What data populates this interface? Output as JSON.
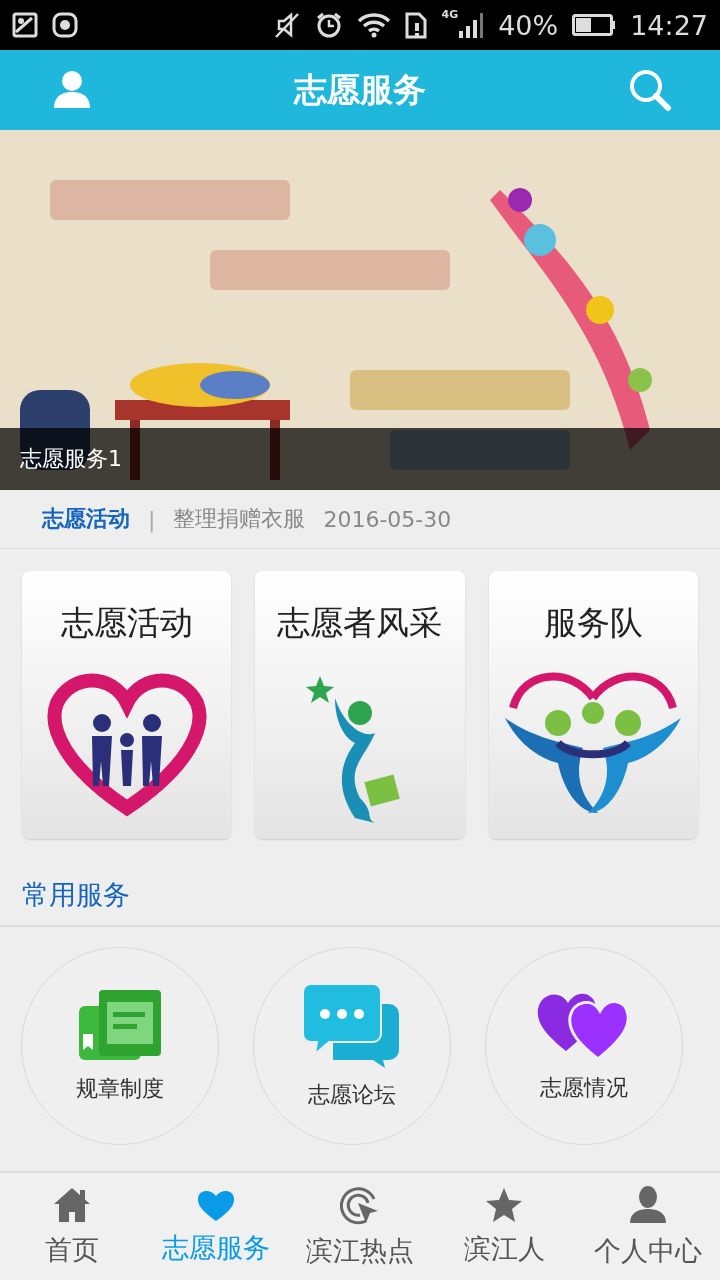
{
  "status_bar": {
    "network": "4G",
    "battery": "40%",
    "time": "14:27"
  },
  "app_bar": {
    "title": "志愿服务"
  },
  "banner": {
    "kind": "picture",
    "caption": "志愿服务1"
  },
  "notice": {
    "category": "志愿活动",
    "separator": "|",
    "title": "整理捐赠衣服",
    "date": "2016-05-30"
  },
  "feature_cards": [
    {
      "label": "志愿活动",
      "kind": "family"
    },
    {
      "label": "志愿者风采",
      "kind": "runner"
    },
    {
      "label": "服务队",
      "kind": "team"
    }
  ],
  "common_services": {
    "heading": "常用服务",
    "items": [
      {
        "label": "规章制度",
        "kind": "book"
      },
      {
        "label": "志愿论坛",
        "kind": "chat"
      },
      {
        "label": "志愿情况",
        "kind": "hearts"
      }
    ]
  },
  "bottom_nav": [
    {
      "label": "首页",
      "kind": "home",
      "selected": false
    },
    {
      "label": "志愿服务",
      "kind": "heart",
      "selected": true
    },
    {
      "label": "滨江热点",
      "kind": "target",
      "selected": false
    },
    {
      "label": "滨江人",
      "kind": "star",
      "selected": false
    },
    {
      "label": "个人中心",
      "kind": "person",
      "selected": false
    }
  ]
}
